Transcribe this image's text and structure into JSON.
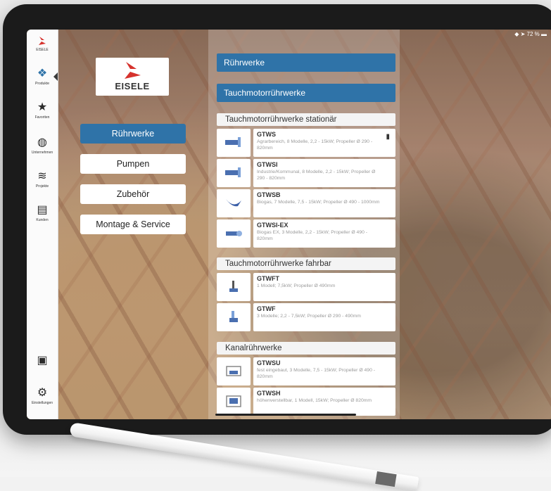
{
  "status_bar": {
    "battery": "72 %"
  },
  "sidebar": {
    "items": [
      {
        "label": "EISELE",
        "icon": "eisele-logo-icon"
      },
      {
        "label": "Produkte",
        "icon": "products-icon"
      },
      {
        "label": "Favoriten",
        "icon": "star-icon"
      },
      {
        "label": "Unternehmen",
        "icon": "globe-icon"
      },
      {
        "label": "Projekte",
        "icon": "layers-icon"
      },
      {
        "label": "Kunden",
        "icon": "contact-card-icon"
      },
      {
        "label": "",
        "icon": "chat-icon"
      },
      {
        "label": "Einstellungen",
        "icon": "gears-icon"
      }
    ]
  },
  "brand": {
    "name": "EISELE",
    "accent": "#2f73a8",
    "logo_red": "#d6322d"
  },
  "nav": {
    "items": [
      {
        "label": "Rührwerke",
        "active": true
      },
      {
        "label": "Pumpen",
        "active": false
      },
      {
        "label": "Zubehör",
        "active": false
      },
      {
        "label": "Montage & Service",
        "active": false
      }
    ]
  },
  "panel": {
    "headers": [
      "Rührwerke",
      "Tauchmotorrührwerke"
    ],
    "sections": [
      {
        "title": "Tauchmotorrührwerke stationär",
        "items": [
          {
            "title": "GTWS",
            "desc": "Agrarbereich, 8 Modelle, 2,2 - 15kW; Propeller Ø 290 - 820mm"
          },
          {
            "title": "GTWSI",
            "desc": "Industrie/Kommunal, 8 Modelle, 2,2 - 15kW; Propeller Ø 290 - 820mm"
          },
          {
            "title": "GTWSB",
            "desc": "Biogas, 7 Modelle, 7,5 - 15kW; Propeller Ø 490 - 1000mm"
          },
          {
            "title": "GTWSI-EX",
            "desc": "Biogas EX, 3 Modelle, 2,2 - 15kW; Propeller Ø 490 - 820mm"
          }
        ]
      },
      {
        "title": "Tauchmotorrührwerke fahrbar",
        "items": [
          {
            "title": "GTWFT",
            "desc": "1 Modell; 7,5kW; Propeller Ø 490mm"
          },
          {
            "title": "GTWF",
            "desc": "3 Modelle; 2,2 - 7,5kW; Propeller Ø 290 - 490mm"
          }
        ]
      },
      {
        "title": "Kanalrührwerke",
        "items": [
          {
            "title": "GTWSU",
            "desc": "fest eingebaut, 3 Modelle, 7,5 - 15kW; Propeller Ø 490 - 820mm"
          },
          {
            "title": "GTWSH",
            "desc": "höhenverstellbar, 1 Modell, 15kW; Propeller Ø 820mm"
          }
        ]
      }
    ]
  }
}
